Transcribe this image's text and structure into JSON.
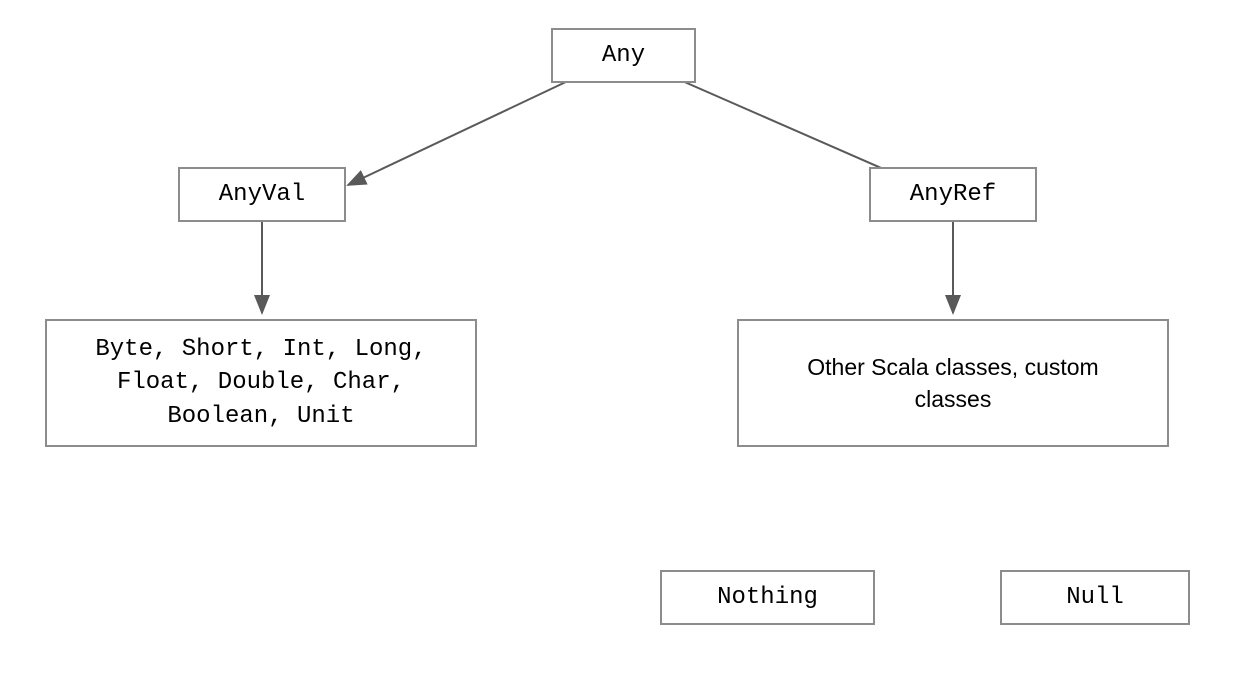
{
  "chart_data": {
    "type": "hierarchy",
    "title": "",
    "nodes": [
      {
        "id": "any",
        "label": "Any"
      },
      {
        "id": "anyval",
        "label": "AnyVal"
      },
      {
        "id": "anyref",
        "label": "AnyRef"
      },
      {
        "id": "valtypes",
        "label": "Byte, Short, Int, Long,\nFloat, Double, Char,\nBoolean, Unit"
      },
      {
        "id": "reftypes",
        "label": "Other Scala classes, custom\nclasses"
      },
      {
        "id": "nothing",
        "label": "Nothing"
      },
      {
        "id": "null",
        "label": "Null"
      }
    ],
    "edges": [
      {
        "from": "any",
        "to": "anyval"
      },
      {
        "from": "any",
        "to": "anyref"
      },
      {
        "from": "anyval",
        "to": "valtypes"
      },
      {
        "from": "anyref",
        "to": "reftypes"
      }
    ]
  },
  "boxes": {
    "any": "Any",
    "anyval": "AnyVal",
    "anyref": "AnyRef",
    "valtypes": "Byte, Short, Int, Long,\nFloat, Double, Char,\nBoolean, Unit",
    "reftypes": "Other Scala classes, custom\nclasses",
    "nothing": "Nothing",
    "null": "Null"
  },
  "colors": {
    "border": "#8c8c8c",
    "arrow": "#595959",
    "text": "#000000",
    "bg": "#ffffff"
  }
}
